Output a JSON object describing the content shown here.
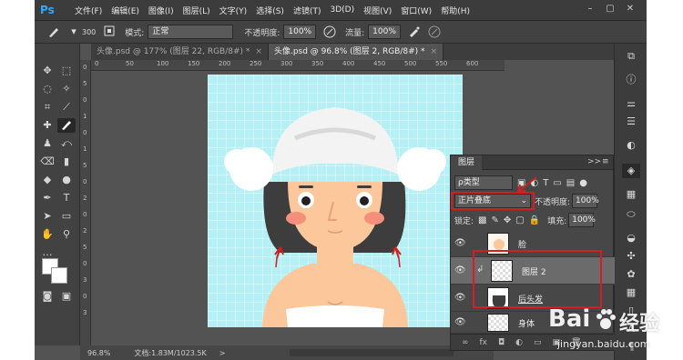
{
  "app": {
    "logo": "Ps"
  },
  "menu": [
    "文件(F)",
    "编辑(E)",
    "图像(I)",
    "图层(L)",
    "文字(Y)",
    "选择(S)",
    "滤镜(T)",
    "3D(D)",
    "视图(V)",
    "窗口(W)",
    "帮助(H)"
  ],
  "window_controls": [
    "–",
    "▢",
    "✕"
  ],
  "options": {
    "brush_size": "300",
    "mode_label": "模式:",
    "mode_value": "正常",
    "opacity_label": "不透明度:",
    "opacity_value": "100%",
    "flow_label": "流量:",
    "flow_value": "100%"
  },
  "tabs": [
    {
      "label": "头像.psd @ 177% (图层 22, RGB/8#) *",
      "close": "×"
    },
    {
      "label": "头像.psd @ 96.8% (图层 2, RGB/8#) *",
      "close": "×"
    }
  ],
  "ruler_top": [
    "0",
    "50",
    "100",
    "150",
    "200",
    "250",
    "300",
    "350",
    "400",
    "450",
    "500",
    "550",
    "600"
  ],
  "ruler_left": [
    "0",
    "5",
    "0",
    "1",
    "0",
    "1",
    "5",
    "0",
    "2",
    "0",
    "2",
    "5",
    "0",
    "3",
    "0",
    "3"
  ],
  "status": {
    "zoom": "96.8%",
    "doc": "文档:1.83M/1023.5K",
    "arrow": ">"
  },
  "layers_panel": {
    "tab": "图层",
    "collapse": ">>",
    "menu": "≡",
    "filter_label": "ρ类型",
    "blend_mode": "正片叠底",
    "opacity_label": "不透明度:",
    "opacity_value": "100%",
    "lock_label": "锁定:",
    "fill_label": "填充:",
    "fill_value": "100%",
    "layers": [
      {
        "name": "脸",
        "selected": false
      },
      {
        "name": "图层 2",
        "selected": true
      },
      {
        "name": "后头发",
        "selected": false
      },
      {
        "name": "身体",
        "selected": false
      }
    ],
    "footer_icons": [
      "∞",
      "fx",
      "◘",
      "◐",
      "▭",
      "▣",
      "🗑"
    ]
  },
  "watermark": {
    "brand_left": "Bai",
    "brand_right": "经验",
    "url": "jingyan.baidu.com"
  },
  "colors": {
    "canvas_bg": "#b5f0f6",
    "highlight": "#d21f1f",
    "skin": "#fcc79a",
    "hair": "#3d3d3d",
    "towel": "#f4f4f4"
  }
}
